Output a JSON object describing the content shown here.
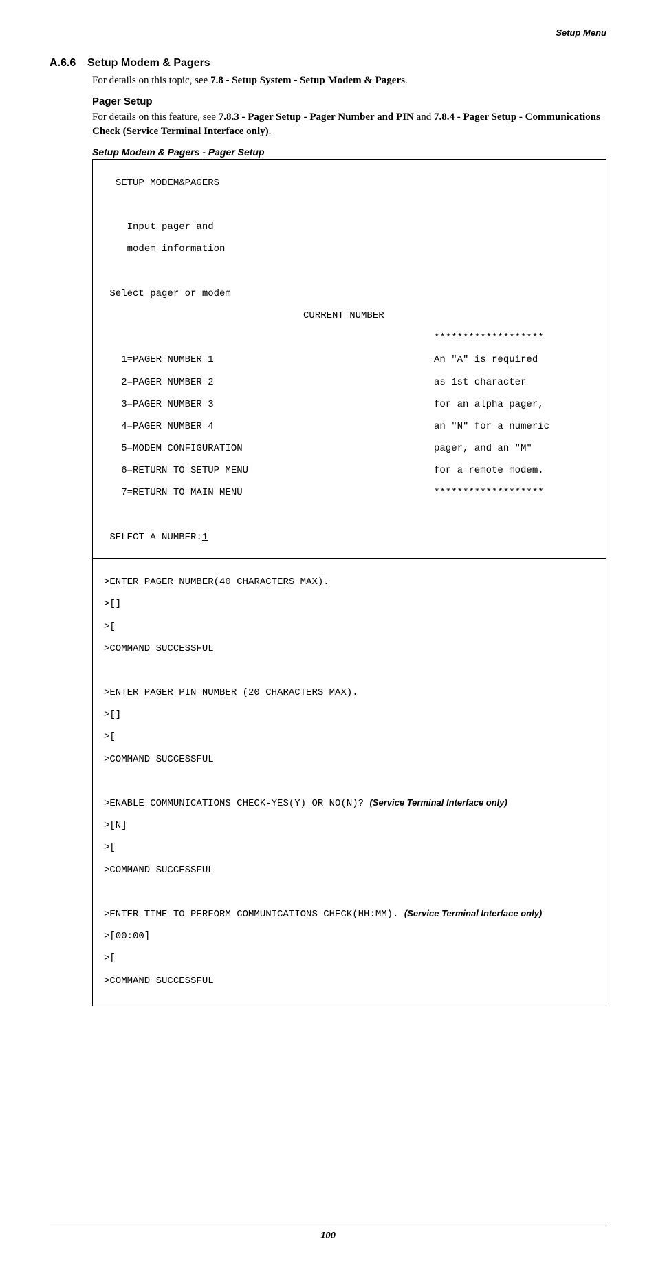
{
  "header": {
    "corner": "Setup Menu"
  },
  "section": {
    "num": "A.6.6",
    "title": "Setup Modem & Pagers",
    "para1a": "For details on this topic, see ",
    "para1b": "7.8 - Setup System - Setup Modem & Pagers",
    "para1c": "."
  },
  "pager": {
    "heading": "Pager Setup",
    "para_a": "For details on this feature, see ",
    "para_b": "7.8.3 - Pager Setup - Pager Number and PIN",
    "para_c": " and ",
    "para_d": "7.8.4 - Pager Setup - Communications Check (Service Terminal Interface only)",
    "para_e": "."
  },
  "caption": "Setup Modem & Pagers - Pager Setup",
  "terminal": {
    "title": "SETUP MODEM&PAGERS",
    "intro1": "Input pager and",
    "intro2": "modem information",
    "select": "Select pager or modem",
    "curnum": "CURRENT NUMBER",
    "stars": "*******************",
    "menu": {
      "m1": "1=PAGER NUMBER 1",
      "m2": "2=PAGER NUMBER 2",
      "m3": "3=PAGER NUMBER 3",
      "m4": "4=PAGER NUMBER 4",
      "m5": "5=MODEM CONFIGURATION",
      "m6": "6=RETURN TO SETUP MENU",
      "m7": "7=RETURN TO MAIN MENU"
    },
    "note": {
      "n1": "An \"A\" is required",
      "n2": "as 1st character",
      "n3": "for an alpha pager,",
      "n4": "an \"N\" for a numeric",
      "n5": "pager, and an \"M\"",
      "n6": "for a remote modem."
    },
    "sel_label": "SELECT A NUMBER:",
    "sel_val": "1",
    "lower": {
      "l1": ">ENTER PAGER NUMBER(40 CHARACTERS MAX).",
      "l2": ">[]",
      "l3": ">[",
      "l4": ">COMMAND SUCCESSFUL",
      "l5": ">ENTER PAGER PIN NUMBER (20 CHARACTERS MAX).",
      "l6": ">[]",
      "l7": ">[",
      "l8": ">COMMAND SUCCESSFUL",
      "l9a": ">ENABLE COMMUNICATIONS CHECK-YES(Y) OR NO(N)?",
      "l9b": "(Service Terminal Interface only)",
      "l10": ">[N]",
      "l11": ">[",
      "l12": ">COMMAND SUCCESSFUL",
      "l13a": ">ENTER TIME TO PERFORM COMMUNICATIONS CHECK(HH:MM).",
      "l13b": "(Service Terminal Interface only)",
      "l14": ">[00:00]",
      "l15": ">[",
      "l16": ">COMMAND SUCCESSFUL"
    }
  },
  "footer": {
    "page": "100"
  }
}
